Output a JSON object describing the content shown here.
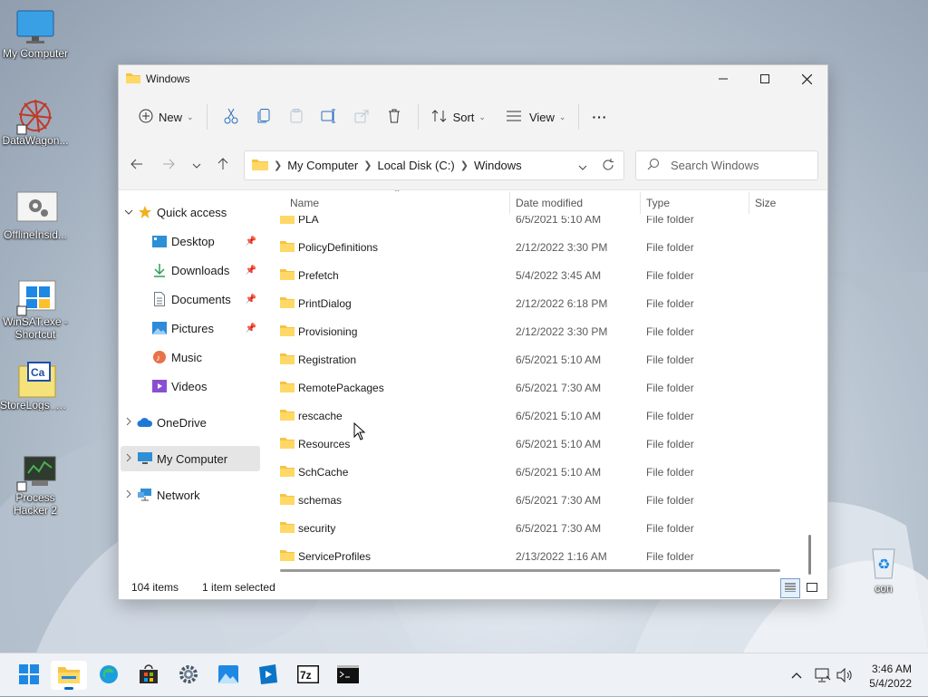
{
  "desktop": {
    "icons": [
      {
        "label": "My Computer"
      },
      {
        "label": "DataWagon..."
      },
      {
        "label": "OfflineInsid..."
      },
      {
        "label": "WinSAT.exe -"
      },
      {
        "label": "Shortcut"
      },
      {
        "label": "StoreLogs_2..."
      },
      {
        "label": "Process"
      },
      {
        "label": "Hacker 2"
      },
      {
        "label": "con"
      }
    ]
  },
  "window": {
    "title": "Windows",
    "toolbar": {
      "new_label": "New",
      "sort_label": "Sort",
      "view_label": "View",
      "more_label": "···"
    },
    "address": {
      "crumbs": [
        "My Computer",
        "Local Disk (C:)",
        "Windows"
      ]
    },
    "search": {
      "placeholder": "Search Windows"
    },
    "nav": {
      "quick_access": "Quick access",
      "items": [
        {
          "label": "Desktop"
        },
        {
          "label": "Downloads"
        },
        {
          "label": "Documents"
        },
        {
          "label": "Pictures"
        },
        {
          "label": "Music"
        },
        {
          "label": "Videos"
        }
      ],
      "onedrive": "OneDrive",
      "my_computer": "My Computer",
      "network": "Network"
    },
    "columns": {
      "name": "Name",
      "date": "Date modified",
      "type": "Type",
      "size": "Size"
    },
    "files": [
      {
        "name": "PLA",
        "date": "6/5/2021 5:10 AM",
        "type": "File folder"
      },
      {
        "name": "PolicyDefinitions",
        "date": "2/12/2022 3:30 PM",
        "type": "File folder"
      },
      {
        "name": "Prefetch",
        "date": "5/4/2022 3:45 AM",
        "type": "File folder"
      },
      {
        "name": "PrintDialog",
        "date": "2/12/2022 6:18 PM",
        "type": "File folder"
      },
      {
        "name": "Provisioning",
        "date": "2/12/2022 3:30 PM",
        "type": "File folder"
      },
      {
        "name": "Registration",
        "date": "6/5/2021 5:10 AM",
        "type": "File folder"
      },
      {
        "name": "RemotePackages",
        "date": "6/5/2021 7:30 AM",
        "type": "File folder"
      },
      {
        "name": "rescache",
        "date": "6/5/2021 5:10 AM",
        "type": "File folder"
      },
      {
        "name": "Resources",
        "date": "6/5/2021 5:10 AM",
        "type": "File folder"
      },
      {
        "name": "SchCache",
        "date": "6/5/2021 5:10 AM",
        "type": "File folder"
      },
      {
        "name": "schemas",
        "date": "6/5/2021 7:30 AM",
        "type": "File folder"
      },
      {
        "name": "security",
        "date": "6/5/2021 7:30 AM",
        "type": "File folder"
      },
      {
        "name": "ServiceProfiles",
        "date": "2/13/2022 1:16 AM",
        "type": "File folder"
      }
    ],
    "status": {
      "items": "104 items",
      "selected": "1 item selected"
    }
  },
  "taskbar": {
    "apps": [
      "start-icon",
      "file-explorer-icon",
      "edge-icon",
      "store-icon",
      "settings-icon",
      "photos-icon",
      "media-player-icon",
      "7zip-icon",
      "terminal-icon"
    ],
    "time": "3:46 AM",
    "date": "5/4/2022"
  }
}
